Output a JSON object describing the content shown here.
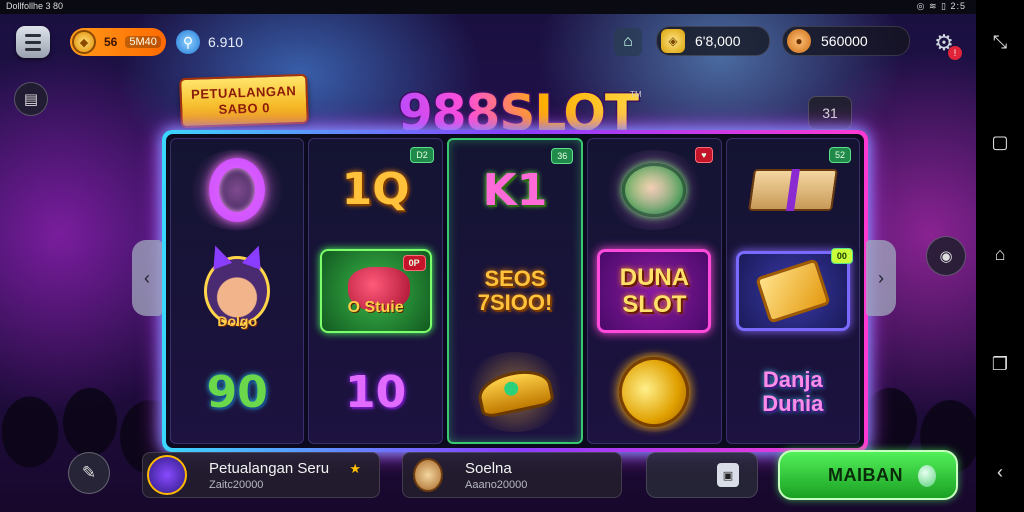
{
  "status_bar": {
    "left_text": "Dollfollhe 3 80",
    "right_text": "◎ ≋ ▯ 2:5"
  },
  "hud": {
    "level_label": "56",
    "level_value": "5M40",
    "search_value": "6.910",
    "gems_value": "6'8,000",
    "coins_value": "560000",
    "settings_badge": "!"
  },
  "event_banner": {
    "line1": "PETUALANGAN",
    "line2": "SABO 0"
  },
  "logo": {
    "text": "988SLOT",
    "tm": "TM"
  },
  "counter": "31",
  "reels": [
    {
      "tag": "",
      "symbols": [
        {
          "type": "ring",
          "text": "O"
        },
        {
          "type": "face",
          "text": "Dolgo"
        },
        {
          "type": "text",
          "text": "90"
        }
      ]
    },
    {
      "tag": "D2",
      "tag_color": "green",
      "highlight": false,
      "symbols": [
        {
          "type": "text",
          "text": "1Q"
        },
        {
          "type": "box-green",
          "text": "O Stuie",
          "tag": "0P"
        },
        {
          "type": "text",
          "text": "10"
        }
      ]
    },
    {
      "tag": "36",
      "tag_color": "green",
      "highlight": true,
      "symbols": [
        {
          "type": "text",
          "text": "K1"
        },
        {
          "type": "text",
          "text": "SEOS 7SIOO!"
        },
        {
          "type": "cap",
          "text": ""
        }
      ]
    },
    {
      "tag": "",
      "tag_color": "red",
      "symbols": [
        {
          "type": "disc",
          "text": ""
        },
        {
          "type": "box-pink",
          "text": "DUNA SLOT"
        },
        {
          "type": "coin",
          "text": ""
        }
      ]
    },
    {
      "tag": "52",
      "tag_color": "green",
      "symbols": [
        {
          "type": "bundle",
          "text": ""
        },
        {
          "type": "box-blue",
          "text": "",
          "tag": "00"
        },
        {
          "type": "text",
          "text": "Danja Dunia"
        }
      ]
    }
  ],
  "bottom": {
    "card1": {
      "name": "Petualangan Seru",
      "sub": "Zaitc20000"
    },
    "card2": {
      "name": "Soelna",
      "sub": "Aaano20000"
    },
    "play_label": "MAIBAN"
  }
}
